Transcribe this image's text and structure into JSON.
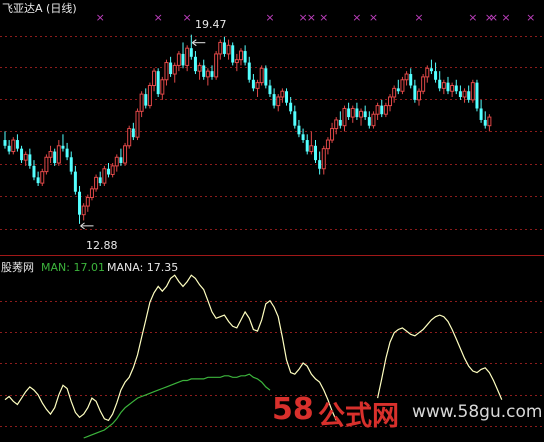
{
  "header": {
    "title": "飞亚达A (日线)"
  },
  "indicator": {
    "name": "股莠网",
    "man_label": "MAN: 17.01",
    "mana_label": "MANA: 17.35"
  },
  "annotations": {
    "high": "19.47",
    "low": "12.88"
  },
  "watermark": {
    "brand_num": "58",
    "brand_text": "公式网",
    "url": "www.58gu.com"
  },
  "colors": {
    "up": "#e04848",
    "down": "#54ffff",
    "man": "#ffffc0",
    "mana": "#3cb43c",
    "grid": "#8c1c1c",
    "signal": "#c040c0",
    "watermark_red": "#d8302c"
  },
  "chart_data": [
    {
      "type": "candlestick",
      "title": "飞亚达A (日线)",
      "ylim": [
        11.9,
        20.4
      ],
      "annotations": [
        {
          "label": "19.47",
          "index": 45,
          "value": 19.47
        },
        {
          "label": "12.88",
          "index": 18,
          "value": 12.88
        }
      ],
      "signal_markers": [
        23,
        37,
        44,
        64,
        72,
        74,
        77,
        85,
        89,
        100,
        113,
        117,
        118,
        121,
        127
      ],
      "ohlc": [
        [
          15.8,
          16.1,
          15.5,
          15.6
        ],
        [
          15.6,
          15.8,
          15.3,
          15.4
        ],
        [
          15.4,
          15.9,
          15.3,
          15.8
        ],
        [
          15.8,
          16.0,
          15.4,
          15.5
        ],
        [
          15.5,
          15.6,
          15.0,
          15.1
        ],
        [
          15.1,
          15.4,
          14.9,
          15.3
        ],
        [
          15.3,
          15.5,
          14.8,
          14.9
        ],
        [
          14.9,
          15.1,
          14.4,
          14.5
        ],
        [
          14.5,
          14.7,
          14.2,
          14.3
        ],
        [
          14.3,
          14.8,
          14.2,
          14.7
        ],
        [
          14.7,
          15.3,
          14.6,
          15.2
        ],
        [
          15.2,
          15.6,
          15.0,
          15.4
        ],
        [
          15.4,
          15.5,
          14.9,
          15.0
        ],
        [
          15.0,
          15.8,
          14.9,
          15.6
        ],
        [
          15.6,
          16.0,
          15.4,
          15.5
        ],
        [
          15.5,
          15.7,
          15.1,
          15.2
        ],
        [
          15.2,
          15.4,
          14.6,
          14.7
        ],
        [
          14.7,
          14.9,
          13.9,
          14.0
        ],
        [
          14.0,
          14.2,
          12.88,
          13.2
        ],
        [
          13.2,
          13.6,
          13.0,
          13.5
        ],
        [
          13.5,
          13.9,
          13.3,
          13.8
        ],
        [
          13.8,
          14.2,
          13.7,
          14.1
        ],
        [
          14.1,
          14.6,
          14.0,
          14.5
        ],
        [
          14.5,
          14.7,
          14.2,
          14.3
        ],
        [
          14.3,
          14.9,
          14.2,
          14.8
        ],
        [
          14.8,
          15.0,
          14.5,
          14.6
        ],
        [
          14.6,
          15.0,
          14.5,
          14.9
        ],
        [
          14.9,
          15.3,
          14.7,
          15.2
        ],
        [
          15.2,
          15.5,
          14.9,
          15.0
        ],
        [
          15.0,
          15.7,
          14.9,
          15.6
        ],
        [
          15.6,
          16.3,
          15.5,
          16.2
        ],
        [
          16.2,
          16.4,
          15.8,
          15.9
        ],
        [
          15.9,
          16.9,
          15.8,
          16.8
        ],
        [
          16.8,
          17.5,
          16.6,
          17.4
        ],
        [
          17.4,
          17.6,
          16.9,
          17.0
        ],
        [
          17.0,
          17.8,
          16.9,
          17.7
        ],
        [
          17.7,
          18.3,
          17.5,
          18.2
        ],
        [
          18.2,
          18.3,
          17.3,
          17.4
        ],
        [
          17.4,
          18.0,
          17.2,
          17.9
        ],
        [
          17.9,
          18.6,
          17.7,
          18.5
        ],
        [
          18.5,
          18.7,
          18.0,
          18.1
        ],
        [
          18.1,
          18.5,
          17.8,
          18.4
        ],
        [
          18.4,
          18.9,
          18.2,
          18.8
        ],
        [
          18.8,
          19.2,
          18.3,
          18.4
        ],
        [
          18.4,
          19.1,
          18.2,
          19.0
        ],
        [
          19.0,
          19.47,
          18.6,
          18.7
        ],
        [
          18.7,
          18.9,
          18.1,
          18.2
        ],
        [
          18.2,
          18.5,
          17.9,
          18.4
        ],
        [
          18.4,
          18.6,
          17.9,
          18.0
        ],
        [
          18.0,
          18.3,
          17.7,
          18.2
        ],
        [
          18.2,
          18.4,
          17.9,
          18.0
        ],
        [
          18.0,
          18.9,
          17.9,
          18.8
        ],
        [
          18.8,
          19.3,
          18.6,
          19.2
        ],
        [
          19.2,
          19.4,
          18.7,
          18.8
        ],
        [
          18.8,
          19.3,
          18.6,
          19.1
        ],
        [
          19.1,
          19.2,
          18.4,
          18.5
        ],
        [
          18.5,
          18.8,
          18.2,
          18.6
        ],
        [
          18.6,
          19.0,
          18.4,
          18.9
        ],
        [
          18.9,
          19.1,
          18.4,
          18.5
        ],
        [
          18.5,
          18.7,
          17.8,
          17.9
        ],
        [
          17.9,
          18.1,
          17.5,
          17.6
        ],
        [
          17.6,
          17.9,
          17.3,
          17.8
        ],
        [
          17.8,
          18.4,
          17.7,
          18.3
        ],
        [
          18.3,
          18.4,
          17.6,
          17.7
        ],
        [
          17.7,
          17.9,
          17.3,
          17.4
        ],
        [
          17.4,
          17.6,
          16.9,
          17.0
        ],
        [
          17.0,
          17.4,
          16.8,
          17.3
        ],
        [
          17.3,
          17.6,
          17.1,
          17.5
        ],
        [
          17.5,
          17.6,
          17.0,
          17.1
        ],
        [
          17.1,
          17.3,
          16.7,
          16.8
        ],
        [
          16.8,
          17.0,
          16.2,
          16.3
        ],
        [
          16.3,
          16.5,
          15.9,
          16.0
        ],
        [
          16.0,
          16.2,
          15.7,
          15.8
        ],
        [
          15.8,
          16.0,
          15.3,
          15.4
        ],
        [
          15.4,
          16.1,
          15.3,
          15.6
        ],
        [
          15.6,
          15.8,
          15.0,
          15.1
        ],
        [
          15.1,
          15.4,
          14.6,
          14.8
        ],
        [
          14.8,
          15.6,
          14.6,
          15.5
        ],
        [
          15.5,
          15.9,
          15.3,
          15.8
        ],
        [
          15.8,
          16.4,
          15.7,
          16.2
        ],
        [
          16.2,
          16.6,
          16.0,
          16.5
        ],
        [
          16.5,
          16.8,
          16.2,
          16.3
        ],
        [
          16.3,
          17.0,
          16.1,
          16.9
        ],
        [
          16.9,
          17.1,
          16.5,
          16.6
        ],
        [
          16.6,
          17.0,
          16.4,
          16.9
        ],
        [
          16.9,
          17.1,
          16.5,
          16.6
        ],
        [
          16.6,
          16.9,
          16.3,
          16.8
        ],
        [
          16.8,
          17.0,
          16.5,
          16.6
        ],
        [
          16.6,
          16.8,
          16.2,
          16.3
        ],
        [
          16.3,
          16.8,
          16.2,
          16.7
        ],
        [
          16.7,
          17.1,
          16.5,
          17.0
        ],
        [
          17.0,
          17.2,
          16.6,
          16.7
        ],
        [
          16.7,
          17.1,
          16.6,
          17.0
        ],
        [
          17.0,
          17.4,
          16.8,
          17.3
        ],
        [
          17.3,
          17.7,
          17.1,
          17.6
        ],
        [
          17.6,
          17.9,
          17.4,
          17.5
        ],
        [
          17.5,
          18.0,
          17.4,
          17.9
        ],
        [
          17.9,
          18.2,
          17.7,
          18.1
        ],
        [
          18.1,
          18.3,
          17.6,
          17.7
        ],
        [
          17.7,
          17.9,
          17.1,
          17.2
        ],
        [
          17.2,
          17.6,
          17.0,
          17.5
        ],
        [
          17.5,
          18.1,
          17.4,
          18.0
        ],
        [
          18.0,
          18.4,
          17.8,
          18.3
        ],
        [
          18.3,
          18.6,
          18.1,
          18.2
        ],
        [
          18.2,
          18.5,
          17.8,
          17.9
        ],
        [
          17.9,
          18.2,
          17.5,
          17.6
        ],
        [
          17.6,
          17.9,
          17.4,
          17.8
        ],
        [
          17.8,
          18.0,
          17.4,
          17.5
        ],
        [
          17.5,
          17.8,
          17.3,
          17.7
        ],
        [
          17.7,
          17.9,
          17.4,
          17.5
        ],
        [
          17.5,
          17.7,
          17.2,
          17.3
        ],
        [
          17.3,
          17.6,
          17.1,
          17.5
        ],
        [
          17.5,
          17.7,
          17.1,
          17.2
        ],
        [
          17.2,
          17.9,
          17.1,
          17.8
        ],
        [
          17.8,
          17.9,
          16.8,
          16.9
        ],
        [
          16.9,
          17.2,
          16.4,
          16.5
        ],
        [
          16.5,
          16.8,
          16.2,
          16.3
        ],
        [
          16.3,
          16.7,
          16.1,
          16.6
        ]
      ]
    },
    {
      "type": "line",
      "title": "股莠网",
      "ylim": [
        10.0,
        20.4
      ],
      "series": [
        {
          "name": "MAN",
          "values": [
            12.4,
            12.6,
            12.3,
            12.1,
            12.5,
            12.9,
            13.2,
            13.0,
            12.7,
            12.2,
            11.8,
            11.5,
            11.9,
            12.7,
            13.3,
            13.1,
            12.3,
            11.6,
            11.3,
            11.5,
            11.9,
            12.5,
            12.3,
            11.7,
            11.2,
            11.1,
            11.5,
            12.2,
            13.0,
            13.5,
            13.8,
            14.4,
            15.2,
            16.3,
            17.4,
            18.5,
            19.1,
            19.5,
            19.2,
            19.5,
            20.0,
            20.2,
            19.8,
            19.5,
            19.8,
            20.2,
            20.0,
            19.6,
            19.3,
            18.6,
            17.9,
            17.5,
            17.6,
            17.7,
            17.3,
            17.0,
            16.9,
            17.4,
            17.9,
            17.5,
            16.8,
            16.7,
            17.4,
            18.4,
            18.6,
            18.2,
            17.6,
            16.3,
            14.9,
            14.1,
            14.0,
            14.3,
            14.7,
            14.5,
            14.0,
            13.7,
            13.5,
            13.0,
            12.4,
            11.7,
            11.1,
            null,
            null,
            null,
            null,
            null,
            null,
            null,
            null,
            null,
            12.5,
            13.7,
            15.0,
            16.0,
            16.6,
            16.8,
            16.9,
            16.7,
            16.5,
            16.4,
            16.6,
            16.8,
            17.1,
            17.4,
            17.6,
            17.7,
            17.6,
            17.3,
            16.8,
            16.2,
            15.6,
            15.0,
            14.5,
            14.2,
            14.1,
            14.3,
            14.4,
            14.1,
            13.6,
            13.0,
            12.4
          ]
        },
        {
          "name": "MANA",
          "values": [
            null,
            null,
            null,
            null,
            null,
            null,
            null,
            null,
            null,
            null,
            null,
            null,
            null,
            null,
            null,
            null,
            null,
            null,
            null,
            10.0,
            10.1,
            10.2,
            10.3,
            10.4,
            10.5,
            10.7,
            10.9,
            11.2,
            11.6,
            11.9,
            12.1,
            12.3,
            12.5,
            12.6,
            12.7,
            12.8,
            12.9,
            13.0,
            13.1,
            13.2,
            13.3,
            13.4,
            13.5,
            13.6,
            13.6,
            13.7,
            13.7,
            13.7,
            13.7,
            13.8,
            13.8,
            13.8,
            13.8,
            13.9,
            13.9,
            13.8,
            13.8,
            13.9,
            13.9,
            14.0,
            13.8,
            13.7,
            13.5,
            13.2,
            13.0
          ]
        }
      ]
    }
  ]
}
